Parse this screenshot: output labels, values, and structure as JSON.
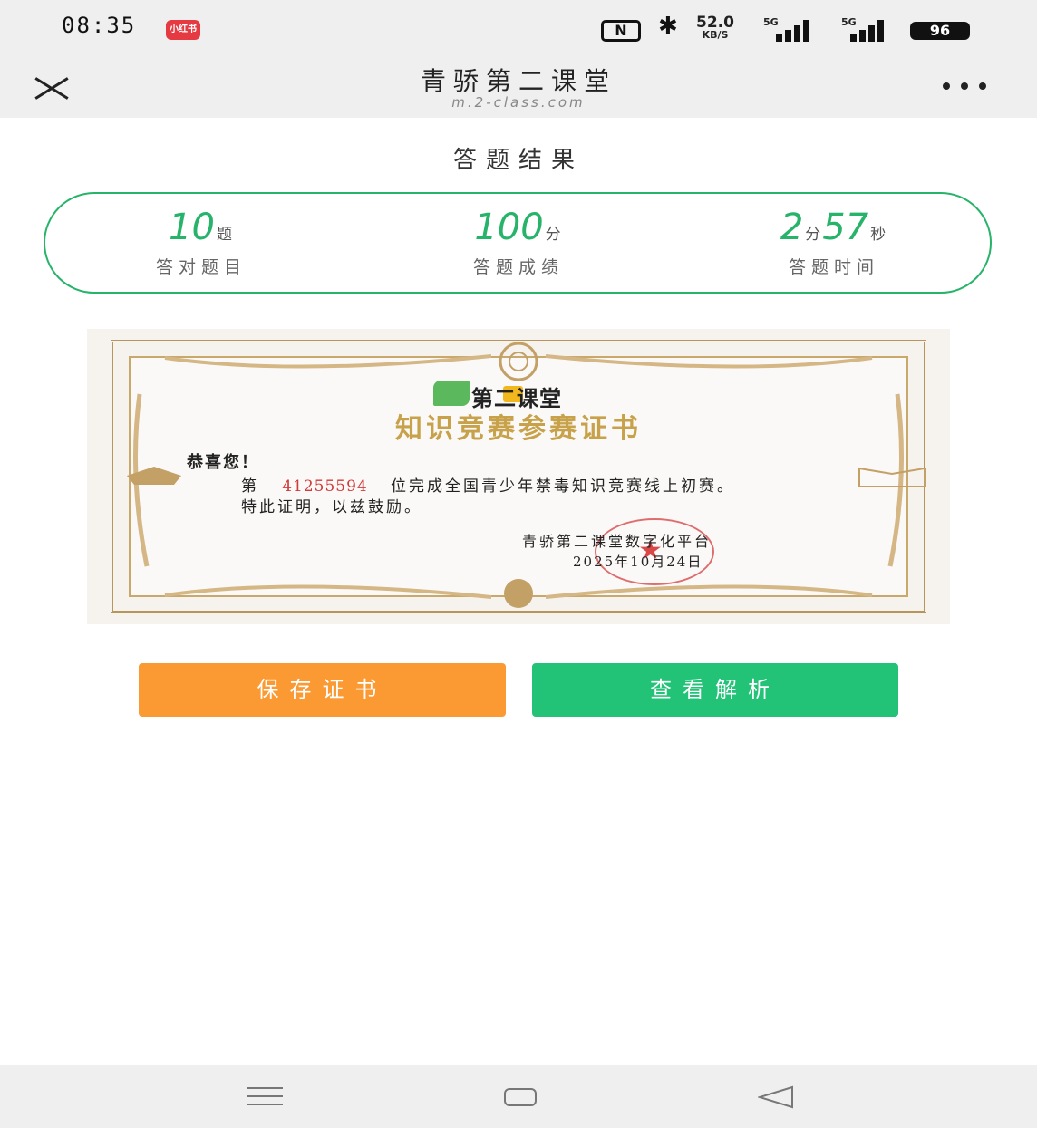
{
  "status_bar": {
    "time": "08:35",
    "app_badge": "小红书",
    "nfc": "N",
    "net_speed_value": "52.0",
    "net_speed_unit": "KB/S",
    "signal1_label": "5G",
    "signal2_label": "5G",
    "battery": "96"
  },
  "nav": {
    "title": "青骄第二课堂",
    "url": "m.2-class.com"
  },
  "result": {
    "title": "答题结果",
    "stats": [
      {
        "value": "10",
        "unit": "题",
        "label": "答对题目"
      },
      {
        "value": "100",
        "unit": "分",
        "label": "答题成绩"
      },
      {
        "value_min": "2",
        "unit_min": "分",
        "value_sec": "57",
        "unit_sec": "秒",
        "label": "答题时间"
      }
    ]
  },
  "certificate": {
    "logo_text": "第二课堂",
    "title": "知识竞赛参赛证书",
    "greeting": "恭喜您！",
    "line1_prefix": "第",
    "number": "41255594",
    "line1_suffix": "位完成全国青少年禁毒知识竞赛线上初赛。",
    "line2": "特此证明，以兹鼓励。",
    "issuer": "青骄第二课堂数字化平台",
    "date": "2025年10月24日"
  },
  "buttons": {
    "save": "保存证书",
    "view": "查看解析"
  },
  "colors": {
    "accent_green": "#22c277",
    "accent_orange": "#fb9a33",
    "cert_gold": "#c8a24a"
  }
}
